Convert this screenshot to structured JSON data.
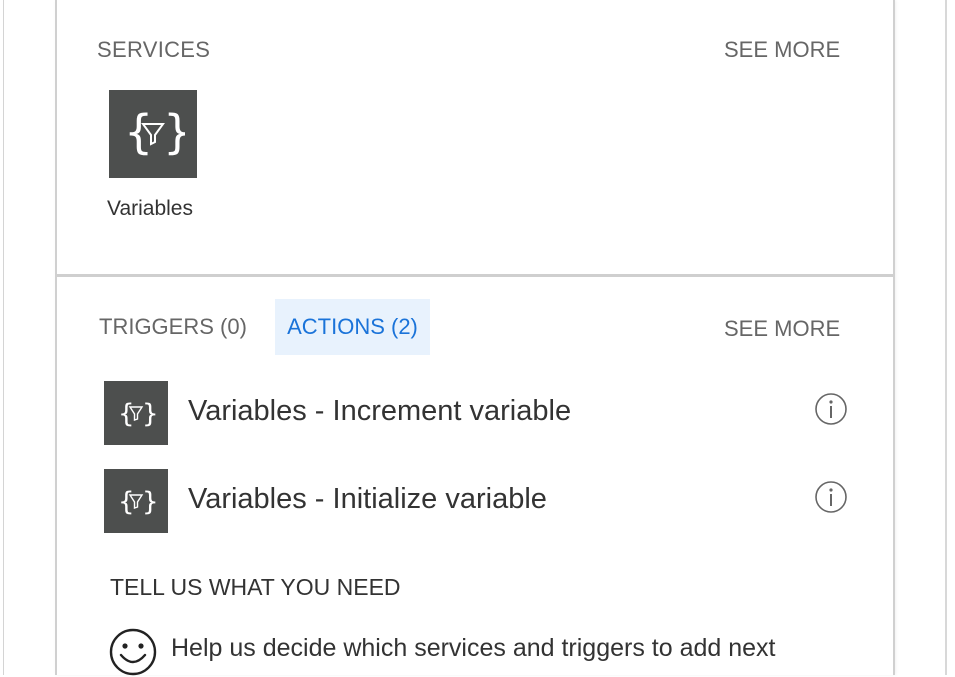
{
  "services_section": {
    "header": "SERVICES",
    "see_more": "SEE MORE",
    "items": [
      {
        "label": "Variables",
        "icon": "variables-icon"
      }
    ]
  },
  "actions_section": {
    "tabs": [
      {
        "label": "TRIGGERS (0)",
        "selected": false
      },
      {
        "label": "ACTIONS (2)",
        "selected": true
      }
    ],
    "see_more": "SEE MORE",
    "actions": [
      {
        "label": "Variables - Increment variable",
        "icon": "variables-icon",
        "info_icon": "info-icon"
      },
      {
        "label": "Variables - Initialize variable",
        "icon": "variables-icon",
        "info_icon": "info-icon"
      }
    ]
  },
  "feedback": {
    "header": "TELL US WHAT YOU NEED",
    "text": "Help us decide which services and triggers to add next",
    "icon": "smiley-icon"
  },
  "colors": {
    "tile_background": "#4d4f4e",
    "accent": "#1a73d9",
    "selected_tab_background": "#e8f2fd",
    "muted_text": "#666666"
  }
}
